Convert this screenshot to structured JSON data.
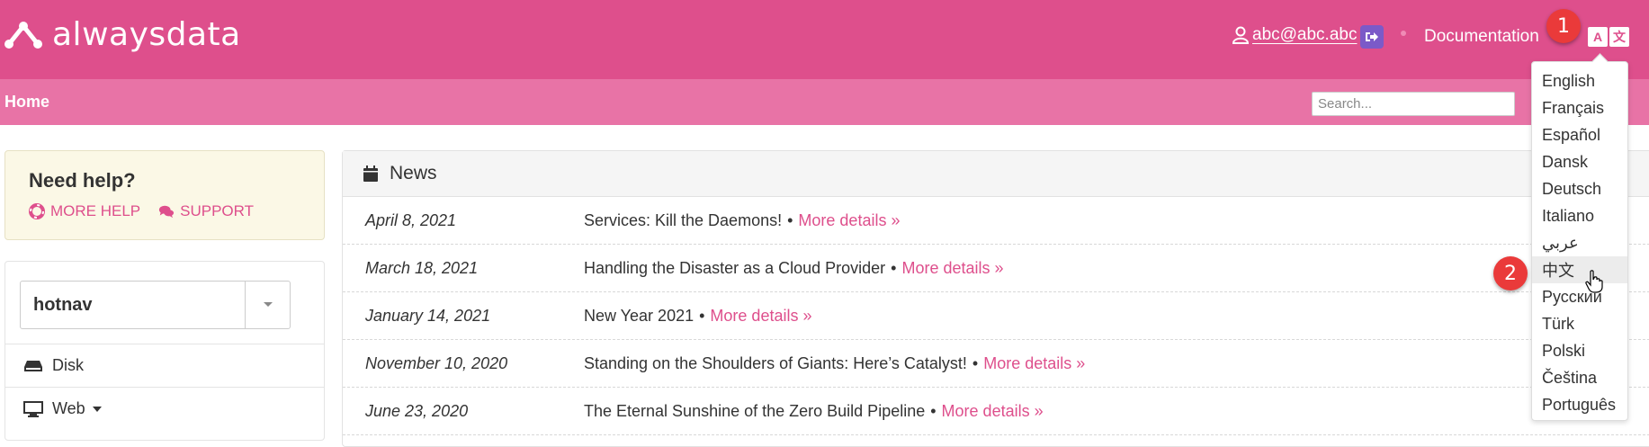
{
  "header": {
    "brand": "alwaysdata",
    "user_email": "abc@abc.abc",
    "documentation_label": "Documentation",
    "lang_icon_left": "A",
    "lang_icon_right": "文"
  },
  "subnav": {
    "home_label": "Home",
    "search_placeholder": "Search..."
  },
  "help": {
    "title": "Need help?",
    "more_help_label": "MORE HELP",
    "support_label": "SUPPORT"
  },
  "sidebar": {
    "account_name": "hotnav",
    "items": [
      {
        "label": "Disk",
        "icon": "disk-icon"
      },
      {
        "label": "Web",
        "icon": "monitor-icon"
      }
    ]
  },
  "news": {
    "title": "News",
    "more_label": "More details »",
    "separator": "•",
    "rows": [
      {
        "date": "April 8, 2021",
        "title": "Services: Kill the Daemons!"
      },
      {
        "date": "March 18, 2021",
        "title": "Handling the Disaster as a Cloud Provider"
      },
      {
        "date": "January 14, 2021",
        "title": "New Year 2021"
      },
      {
        "date": "November 10, 2020",
        "title": "Standing on the Shoulders of Giants: Here’s Catalyst!"
      },
      {
        "date": "June 23, 2020",
        "title": "The Eternal Sunshine of the Zero Build Pipeline"
      }
    ]
  },
  "languages": {
    "items": [
      "English",
      "Français",
      "Español",
      "Dansk",
      "Deutsch",
      "Italiano",
      "عربي",
      "中文",
      "Русский",
      "Türk",
      "Polski",
      "Čeština",
      "Português"
    ],
    "hovered": "中文"
  },
  "markers": {
    "step1": "1",
    "step2": "2"
  },
  "colors": {
    "topbar": "#de4f8c",
    "subnav": "#e873a6",
    "accent": "#de4f8c",
    "marker": "#ea3a3a"
  }
}
